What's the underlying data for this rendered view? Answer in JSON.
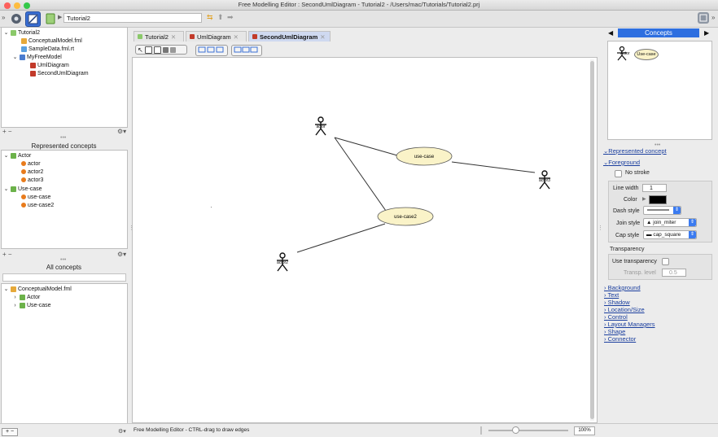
{
  "window": {
    "title": "Free Modelling Editor : SecondUmlDiagram - Tutorial2 - /Users/mac/Tutorials/Tutorial2.prj"
  },
  "toolbar": {
    "project_field": "Tutorial2"
  },
  "project_tree": {
    "root": "Tutorial2",
    "items": [
      "ConceptualModel.fml",
      "SampleData.fml.rt",
      "MyFreeModel",
      "UmlDiagram",
      "SecondUmlDiagram"
    ]
  },
  "represented": {
    "title": "Represented concepts",
    "groups": [
      {
        "label": "Actor",
        "children": [
          "actor",
          "actor2",
          "actor3"
        ]
      },
      {
        "label": "Use-case",
        "children": [
          "use-case",
          "use-case2"
        ]
      }
    ]
  },
  "all_concepts": {
    "title": "All concepts",
    "root": "ConceptualModel.fml",
    "children": [
      "Actor",
      "Use-case"
    ]
  },
  "tabs": [
    {
      "label": "Tutorial2"
    },
    {
      "label": "UmlDiagram"
    },
    {
      "label": "SecondUmlDiagram"
    }
  ],
  "diagram": {
    "actors": [
      {
        "label": "actor"
      },
      {
        "label": "actor3"
      },
      {
        "label": "actor2"
      }
    ],
    "usecases": [
      {
        "label": "use-case"
      },
      {
        "label": "use-case2"
      }
    ]
  },
  "palette": {
    "title": "Concepts",
    "items": [
      "Actor",
      "Use-case"
    ]
  },
  "inspector": {
    "represented_concept": "Represented concept",
    "foreground": "Foreground",
    "no_stroke": "No stroke",
    "line_width_label": "Line width",
    "line_width_value": "1",
    "color_label": "Color",
    "dash_style_label": "Dash style",
    "join_style_label": "Join style",
    "join_style_value": "join_miter",
    "cap_style_label": "Cap style",
    "cap_style_value": "cap_square",
    "transparency_title": "Transparency",
    "use_transparency": "Use transparency",
    "transp_level_label": "Transp. level",
    "transp_level_value": "0.5",
    "sections": [
      "Background",
      "Text",
      "Shadow",
      "Location/Size",
      "Control",
      "Layout Managers",
      "Shape",
      "Connector"
    ]
  },
  "status": {
    "message": "Free Modelling Editor - CTRL-drag to draw edges",
    "zoom": "100%"
  },
  "colors": {
    "accent": "#2e6fe0",
    "usecase_fill": "#faf3c8"
  }
}
